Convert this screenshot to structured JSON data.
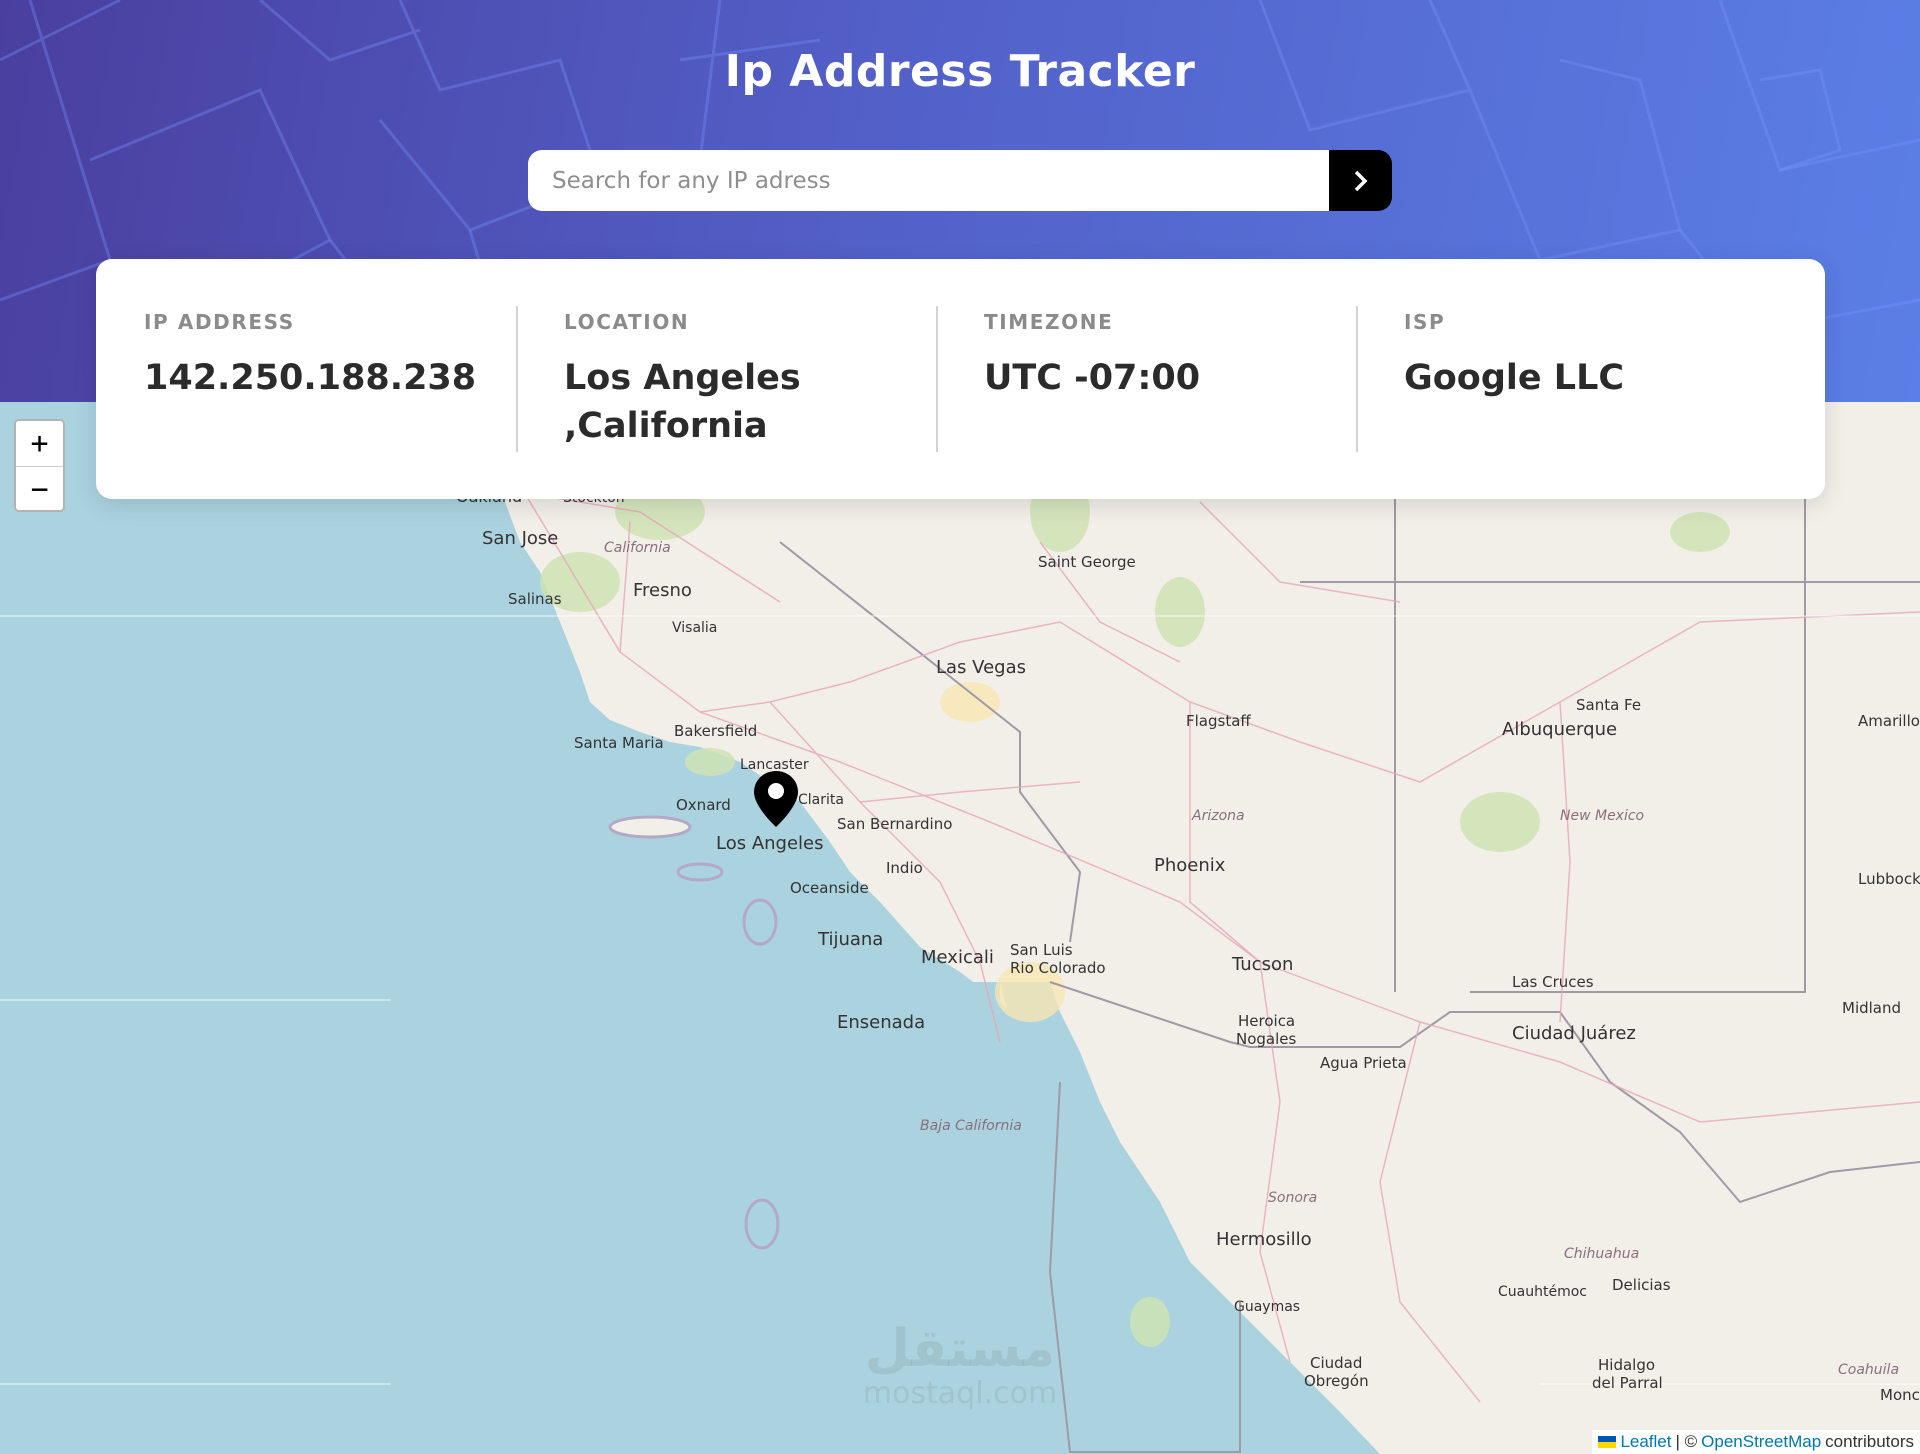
{
  "header": {
    "title": "Ip Address Tracker",
    "search_placeholder": "Search for any IP adress",
    "search_value": "",
    "submit_icon": "chevron-right-icon"
  },
  "stats": [
    {
      "label": "IP ADDRESS",
      "value": "142.250.188.238"
    },
    {
      "label": "LOCATION",
      "value": "Los Angeles ,California"
    },
    {
      "label": "TIMEZONE",
      "value": "UTC -07:00"
    },
    {
      "label": "ISP",
      "value": "Google LLC"
    }
  ],
  "map": {
    "zoom_in_label": "+",
    "zoom_out_label": "−",
    "marker_icon": "map-pin-icon",
    "cities": [
      "Oakland",
      "Stockton",
      "San Jose",
      "Salinas",
      "Fresno",
      "Visalia",
      "Saint George",
      "Las Vegas",
      "Santa Fe",
      "Albuquerque",
      "Amarillo",
      "Flagstaff",
      "Bakersfield",
      "Santa Maria",
      "Lancaster",
      "Clarita",
      "Oxnard",
      "San Bernardino",
      "Los Angeles",
      "Indio",
      "Oceanside",
      "Phoenix",
      "Lubbock",
      "Tijuana",
      "Mexicali",
      "San Luis",
      "Rio Colorado",
      "Tucson",
      "Las Cruces",
      "Midland",
      "Ensenada",
      "Heroica",
      "Nogales",
      "Agua Prieta",
      "Ciudad Juárez",
      "Hermosillo",
      "Guaymas",
      "Cuauhtémoc",
      "Delicias",
      "Ciudad",
      "Obregón",
      "Hidalgo",
      "del Parral",
      "Monc"
    ],
    "regions": [
      "California",
      "Arizona",
      "New Mexico",
      "Baja California",
      "Sonora",
      "Chihuahua",
      "Coahuila"
    ],
    "attribution": {
      "leaflet": "Leaflet",
      "separator": "| ©",
      "osm": "OpenStreetMap",
      "suffix": "contributors"
    },
    "watermark": {
      "line1": "مستقل",
      "line2": "mostaql.com"
    }
  }
}
